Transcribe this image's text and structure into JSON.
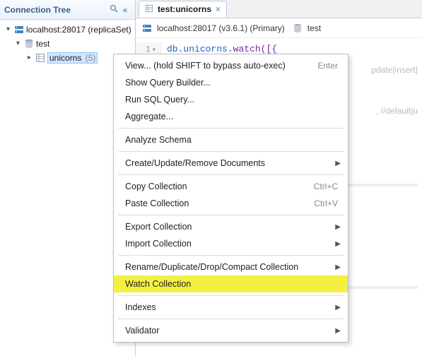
{
  "sidebar": {
    "title": "Connection Tree",
    "host_label": "localhost:28017 (replicaSet)",
    "db_label": "test",
    "coll_label": "unicorns",
    "coll_count": "(5)"
  },
  "tab": {
    "label": "test:unicorns"
  },
  "subheader": {
    "host": "localhost:28017 (v3.6.1) (Primary)",
    "db": "test"
  },
  "code": {
    "line_no": "1",
    "db": "db",
    "dot1": ".",
    "coll": "unicorns",
    "dot2": ".",
    "fn": "watch",
    "open": "([",
    "brace": "{"
  },
  "ghost": {
    "line1": "pdate|insert|",
    "line2": ", //default|u"
  },
  "menu": {
    "view": "View... (hold SHIFT to bypass auto-exec)",
    "view_accel": "Enter",
    "show_qb": "Show Query Builder...",
    "run_sql": "Run SQL Query...",
    "aggregate": "Aggregate...",
    "analyze": "Analyze Schema",
    "crud": "Create/Update/Remove Documents",
    "copy": "Copy Collection",
    "copy_accel": "Ctrl+C",
    "paste": "Paste Collection",
    "paste_accel": "Ctrl+V",
    "export": "Export Collection",
    "import": "Import Collection",
    "rddc": "Rename/Duplicate/Drop/Compact Collection",
    "watch": "Watch Collection",
    "indexes": "Indexes",
    "validator": "Validator"
  }
}
